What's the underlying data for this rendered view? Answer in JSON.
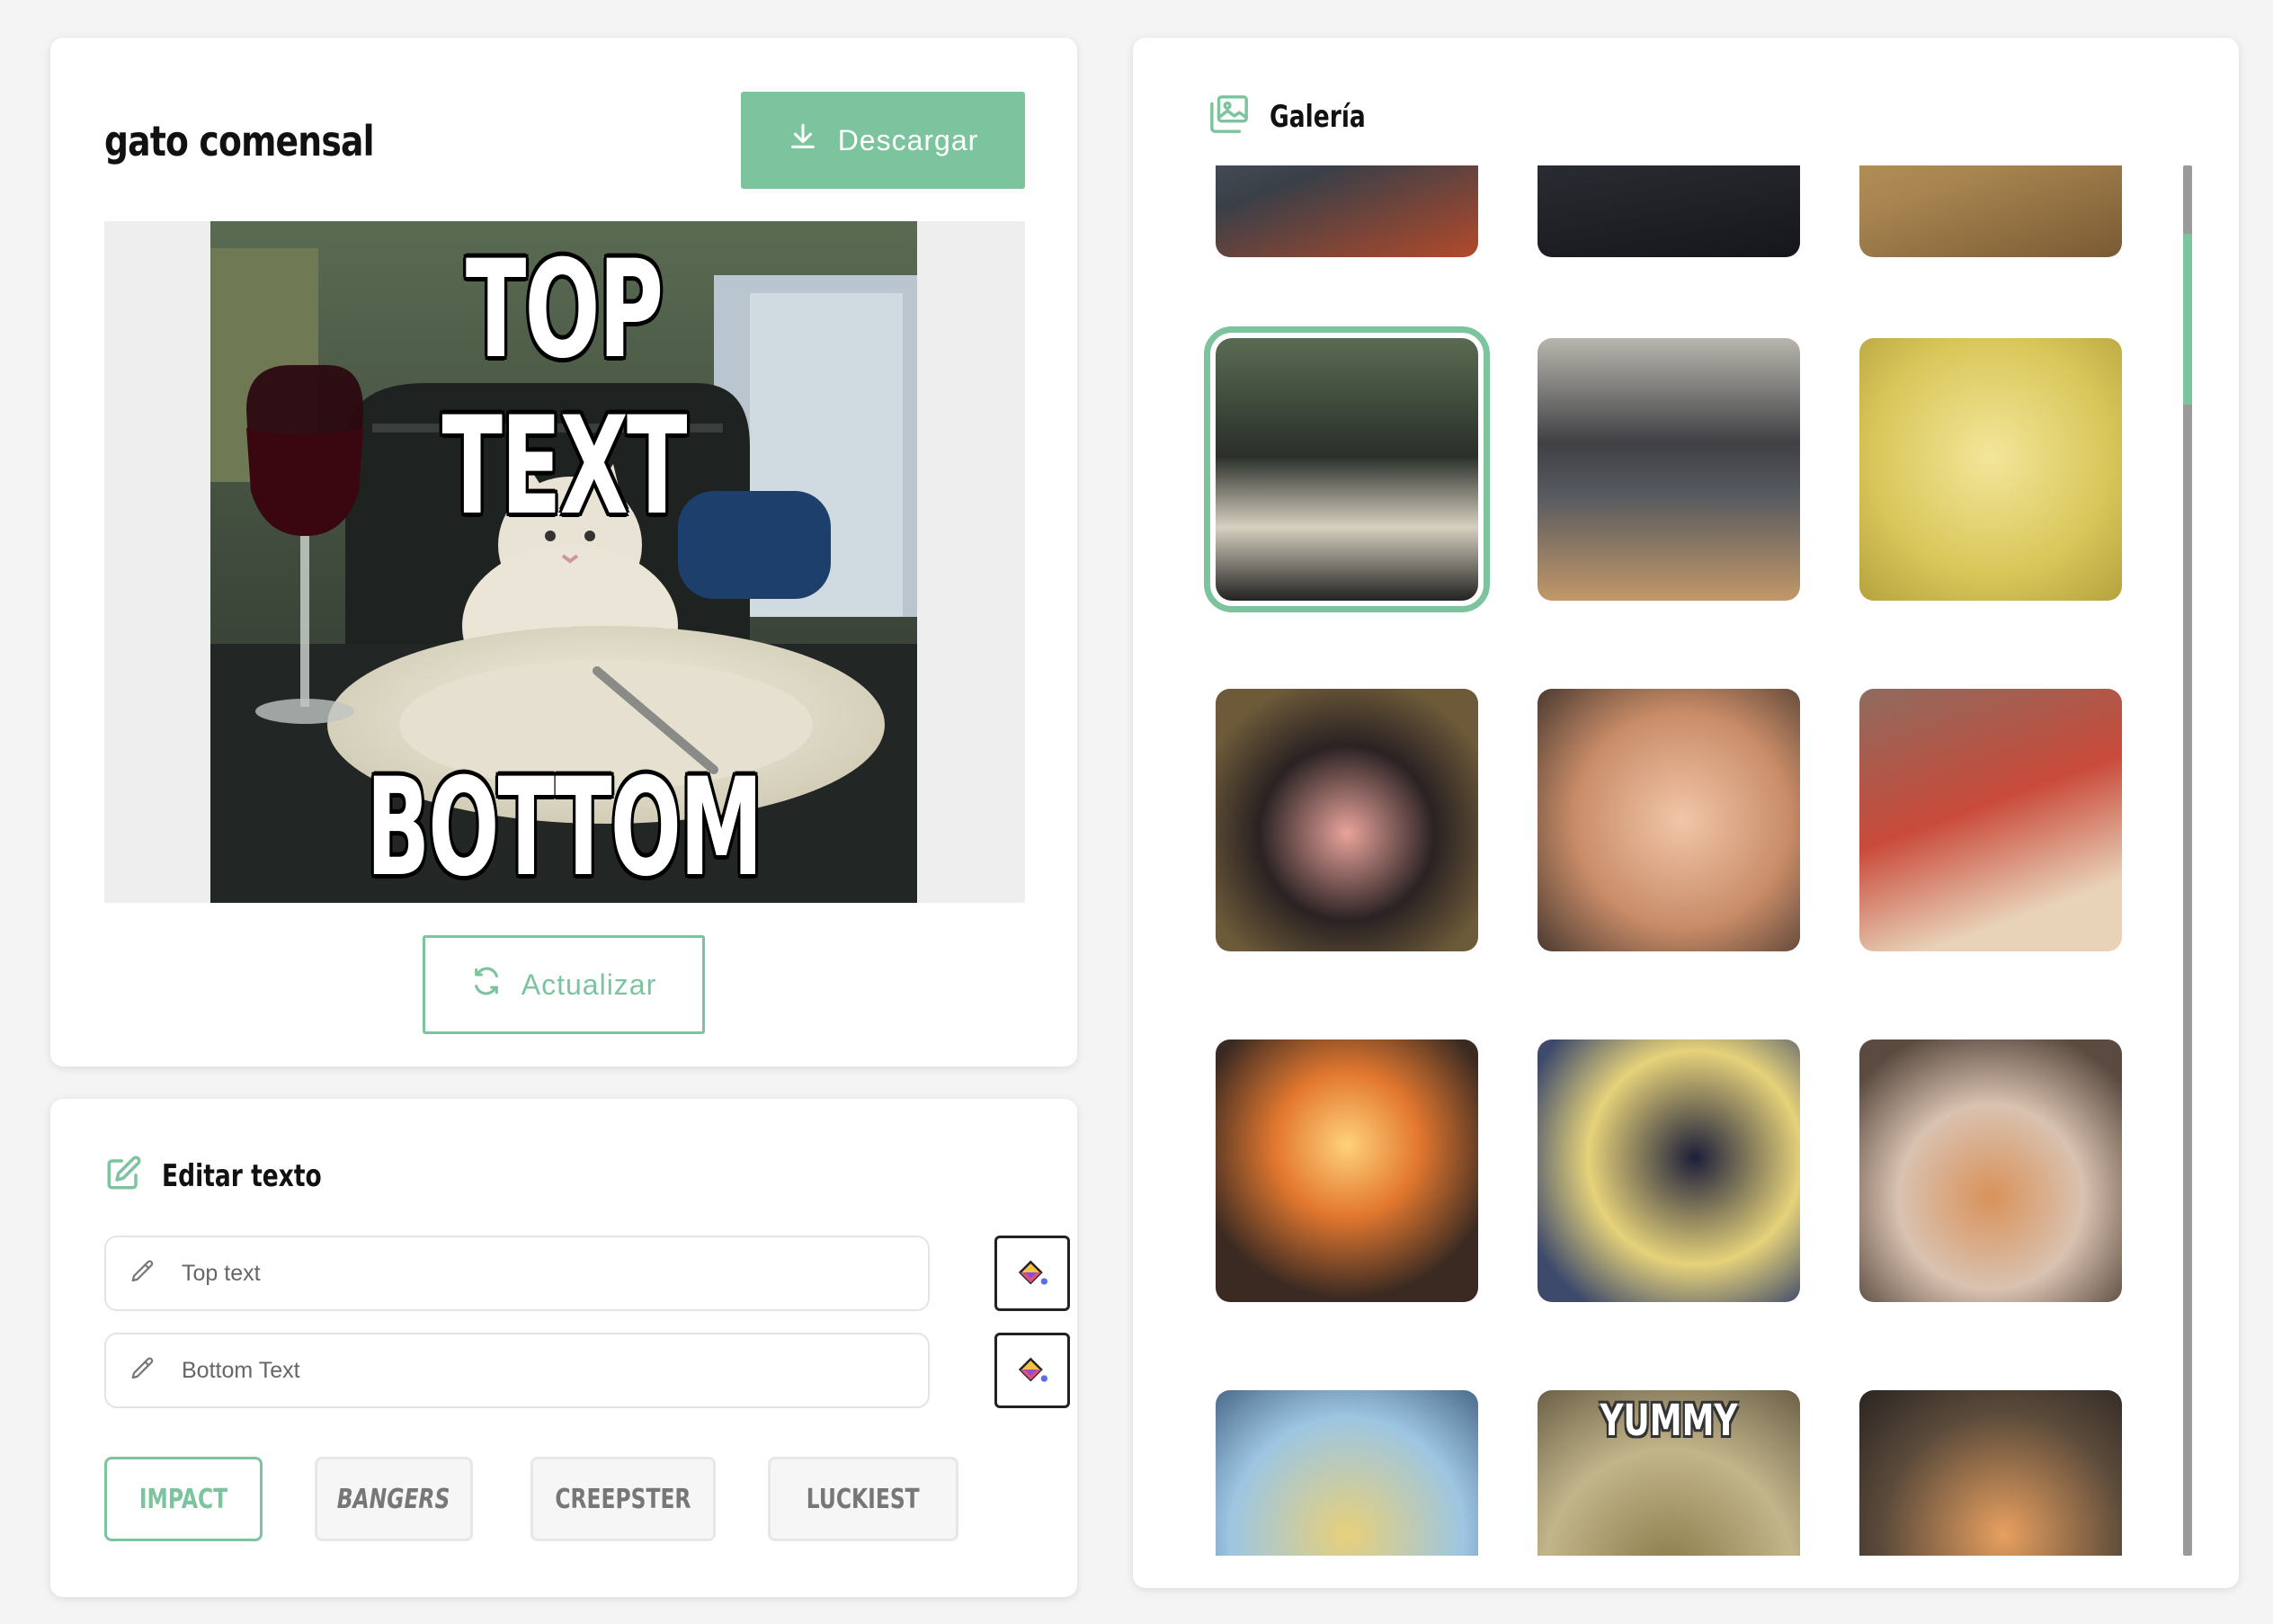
{
  "editor": {
    "meme_title": "gato comensal",
    "download_label": "Descargar",
    "refresh_label": "Actualizar",
    "meme_top_text": "TOP TEXT",
    "meme_bottom_text": "BOTTOM TEXT"
  },
  "text_editor": {
    "title": "Editar texto",
    "inputs": [
      {
        "placeholder": "Top text",
        "value": ""
      },
      {
        "placeholder": "Bottom Text",
        "value": ""
      }
    ],
    "fonts": [
      "IMPACT",
      "BANGERS",
      "CREEPSTER",
      "LUCKIEST"
    ],
    "selected_font": "IMPACT"
  },
  "gallery": {
    "title": "Galería",
    "thumbnails": [
      {
        "label": ""
      },
      {
        "label": ""
      },
      {
        "label": ""
      },
      {
        "label": ""
      },
      {
        "label": ""
      },
      {
        "label": ""
      },
      {
        "label": ""
      },
      {
        "label": ""
      },
      {
        "label": ""
      },
      {
        "label": ""
      },
      {
        "label": ""
      },
      {
        "label": ""
      },
      {
        "label": ""
      },
      {
        "label": "YUMMY"
      },
      {
        "label": ""
      }
    ]
  },
  "colors": {
    "accent": "#7cc49d",
    "background": "#f4f4f4",
    "card": "#ffffff",
    "scrollbar": "#9a9a9a"
  },
  "icons": {
    "download": "download-icon",
    "refresh": "refresh-icon",
    "edit": "edit-square-icon",
    "pencil": "pencil-icon",
    "color": "paint-bucket-icon",
    "gallery": "image-gallery-icon"
  }
}
